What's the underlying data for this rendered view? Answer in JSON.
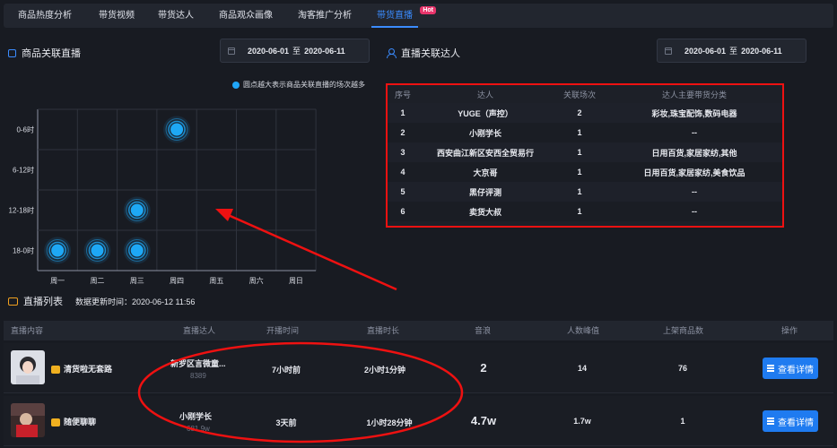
{
  "tabs": [
    {
      "label": "商品热度分析"
    },
    {
      "label": "带货视频"
    },
    {
      "label": "带货达人"
    },
    {
      "label": "商品观众画像"
    },
    {
      "label": "淘客推广分析"
    },
    {
      "label": "带货直播",
      "badge": "Hot",
      "active": true
    }
  ],
  "left_section": {
    "title": "商品关联直播",
    "date_from": "2020-06-01",
    "date_sep": "至",
    "date_to": "2020-06-11",
    "legend": "圆点越大表示商品关联直播的场次越多"
  },
  "chart_data": {
    "type": "scatter",
    "x_categories": [
      "周一",
      "周二",
      "周三",
      "周四",
      "周五",
      "周六",
      "周日"
    ],
    "y_categories": [
      "0-6时",
      "6-12时",
      "12-18时",
      "18-0时"
    ],
    "y_tick_labels": [
      "0-6时",
      "6-12时",
      "12-18时",
      "18-0时"
    ],
    "points": [
      {
        "x": "周四",
        "y": "0-6时"
      },
      {
        "x": "周三",
        "y": "12-18时"
      },
      {
        "x": "周一",
        "y": "18-0时"
      },
      {
        "x": "周二",
        "y": "18-0时"
      },
      {
        "x": "周三",
        "y": "18-0时"
      }
    ],
    "point_color": "#1ea8f5",
    "grid": true
  },
  "right_section": {
    "title": "直播关联达人",
    "date_from": "2020-06-01",
    "date_sep": "至",
    "date_to": "2020-06-11",
    "columns": [
      "序号",
      "达人",
      "关联场次",
      "达人主要带货分类"
    ],
    "rows": [
      {
        "idx": "1",
        "name": "YUGE（声控）",
        "count": "2",
        "category": "彩妆,珠宝配饰,数码电器"
      },
      {
        "idx": "2",
        "name": "小刚学长",
        "count": "1",
        "category": "--"
      },
      {
        "idx": "3",
        "name": "西安曲江新区安西全贸易行",
        "count": "1",
        "category": "日用百货,家居家纺,其他"
      },
      {
        "idx": "4",
        "name": "大京哥",
        "count": "1",
        "category": "日用百货,家居家纺,美食饮品"
      },
      {
        "idx": "5",
        "name": "黑仔评测",
        "count": "1",
        "category": "--"
      },
      {
        "idx": "6",
        "name": "卖货大叔",
        "count": "1",
        "category": "--"
      }
    ]
  },
  "live_list": {
    "title": "直播列表",
    "update_label": "数据更新时间：",
    "update_time": "2020-06-12 11:56",
    "columns": [
      "直播内容",
      "直播达人",
      "开播时间",
      "直播时长",
      "音浪",
      "人数峰值",
      "上架商品数",
      "操作"
    ],
    "rows": [
      {
        "content": "清货啦无套路",
        "anchor": "新罗区言微童...",
        "anchor_sub": "8389",
        "start": "7小时前",
        "duration": "2小时1分钟",
        "yinlang": "2",
        "peak": "14",
        "goods": "76",
        "action": "查看详情"
      },
      {
        "content": "随便聊聊",
        "anchor": "小刚学长",
        "anchor_sub": "681.9w",
        "start": "3天前",
        "duration": "1小时28分钟",
        "yinlang": "4.7w",
        "peak": "1.7w",
        "goods": "1",
        "action": "查看详情"
      }
    ]
  },
  "colors": {
    "accent": "#3b8cff",
    "annotation_red": "#ee1111",
    "bubble": "#1ea8f5"
  }
}
